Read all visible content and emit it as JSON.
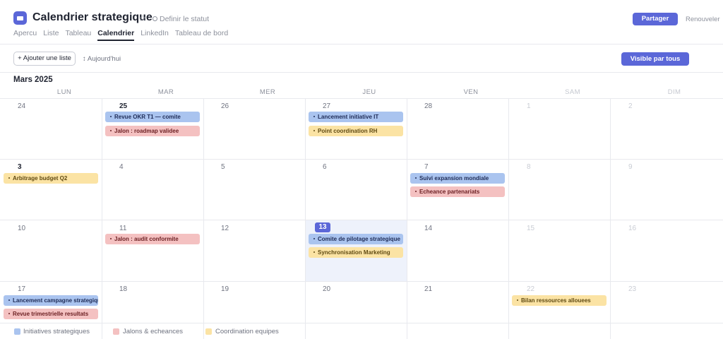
{
  "header": {
    "title": "Calendrier strategique",
    "status_label": "Definir le statut",
    "share_label": "Partager",
    "renew_label": "Renouveler",
    "tabs": [
      "Apercu",
      "Liste",
      "Tableau",
      "Calendrier",
      "LinkedIn",
      "Tableau de bord"
    ],
    "active_tab": "Calendrier"
  },
  "toolbar": {
    "add_list_label": "+ Ajouter une liste",
    "today_label": "↕ Aujourd'hui",
    "visibility_label": "Visible par tous"
  },
  "calendar": {
    "month": "Mars 2025",
    "weekdays": [
      "LUN",
      "MAR",
      "MER",
      "JEU",
      "VEN",
      "SAM",
      "DIM"
    ],
    "weeks": [
      [
        "24",
        "25",
        "26",
        "27",
        "28",
        "1",
        "2"
      ],
      [
        "3",
        "4",
        "5",
        "6",
        "7",
        "8",
        "9"
      ],
      [
        "10",
        "11",
        "12",
        "13",
        "14",
        "15",
        "16"
      ],
      [
        "17",
        "18",
        "19",
        "20",
        "21",
        "22",
        "23"
      ]
    ],
    "today": "13",
    "events": [
      {
        "label": "Revue OKR T1 — comite",
        "category": "initiatives"
      },
      {
        "label": "Jalon : roadmap validee",
        "category": "jalons"
      },
      {
        "label": "Lancement initiative IT",
        "category": "initiatives"
      },
      {
        "label": "Point coordination RH",
        "category": "coordination"
      },
      {
        "label": "Arbitrage budget Q2",
        "category": "coordination"
      },
      {
        "label": "Suivi expansion mondiale",
        "category": "initiatives"
      },
      {
        "label": "Echeance partenariats",
        "category": "jalons"
      },
      {
        "label": "Jalon : audit conformite",
        "category": "jalons"
      },
      {
        "label": "Comite de pilotage strategique",
        "category": "initiatives"
      },
      {
        "label": "Synchronisation Marketing",
        "category": "coordination"
      },
      {
        "label": "Lancement campagne strategique",
        "category": "initiatives"
      },
      {
        "label": "Revue trimestrielle resultats",
        "category": "jalons"
      },
      {
        "label": "Bilan ressources allouees",
        "category": "coordination"
      }
    ]
  },
  "legend": [
    {
      "label": "Initiatives strategiques",
      "color": "#aac4ef"
    },
    {
      "label": "Jalons & echeances",
      "color": "#f4c1c1"
    },
    {
      "label": "Coordination equipes",
      "color": "#fbe3a4"
    }
  ],
  "colors": {
    "accent": "#5b67d8",
    "today_background": "#eef2fb"
  }
}
